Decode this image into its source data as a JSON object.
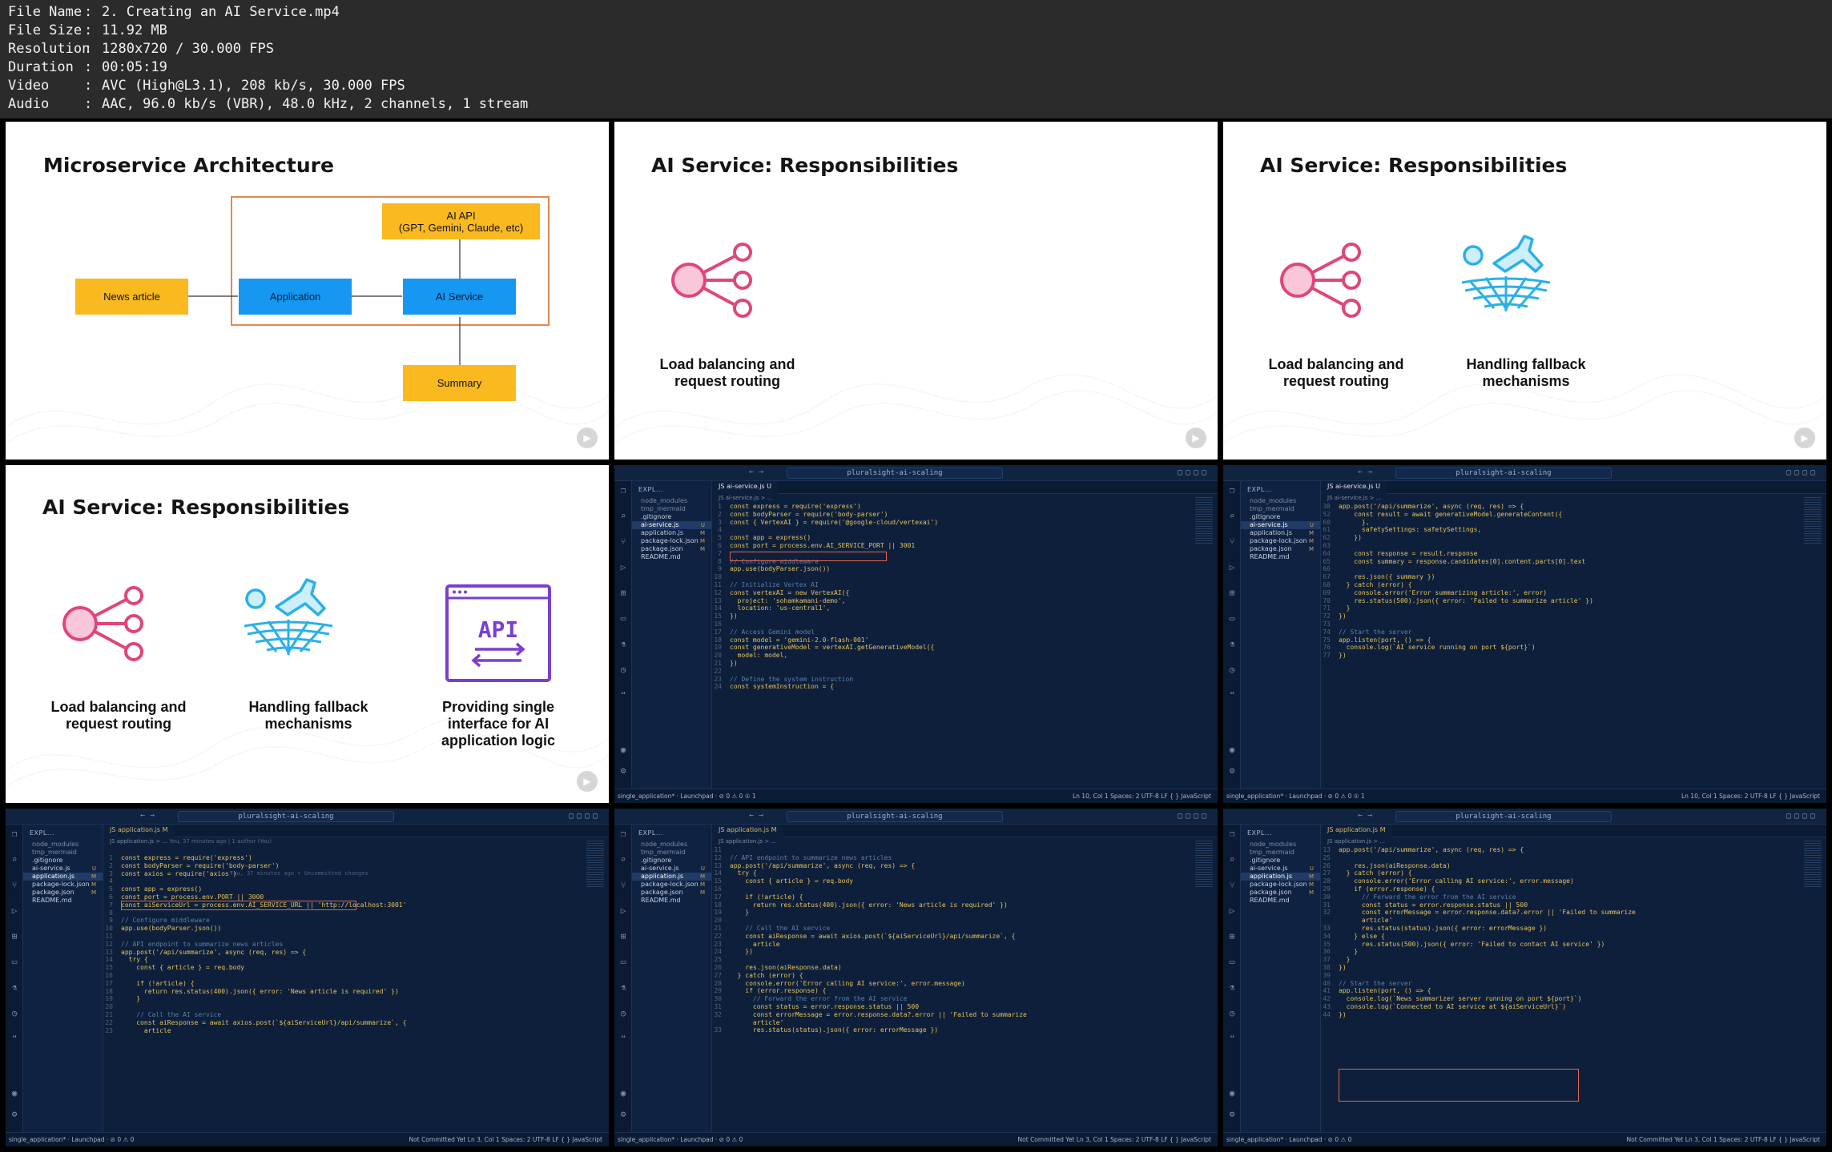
{
  "file_info": [
    {
      "key": "File Name",
      "value": "2. Creating an AI Service.mp4"
    },
    {
      "key": "File Size",
      "value": "11.92 MB"
    },
    {
      "key": "Resolution",
      "value": "1280x720 / 30.000 FPS"
    },
    {
      "key": "Duration",
      "value": "00:05:19"
    },
    {
      "key": "Video",
      "value": "AVC (High@L3.1), 208 kb/s, 30.000 FPS"
    },
    {
      "key": "Audio",
      "value": "AAC, 96.0 kb/s (VBR), 48.0 kHz, 2 channels, 1 stream"
    }
  ],
  "separator": ":",
  "slides": {
    "arch": {
      "title": "Microservice Architecture",
      "news": "News article",
      "application": "Application",
      "ai_service": "AI Service",
      "ai_api": "AI API",
      "ai_api_sub": "(GPT, Gemini, Claude, etc)",
      "summary": "Summary"
    },
    "resp_title": "AI Service: Responsibilities",
    "resp_load": "Load balancing and request routing",
    "resp_fallback": "Handling fallback mechanisms",
    "resp_interface": "Providing single interface for AI application logic",
    "api_icon_text": "API"
  },
  "editor": {
    "search": "pluralsight-ai-scaling",
    "explorer": "EXPL...",
    "files": {
      "node_modules": "node_modules",
      "tmp_mermaid": "tmp_mermaid",
      "gitignore": ".gitignore",
      "ai_service": "ai-service.js",
      "application": "application.js",
      "package_lock": "package-lock.json",
      "package": "package.json",
      "readme": "README.md"
    },
    "status_u": "U",
    "status_m": "M",
    "tab_ai": "JS ai-service.js U",
    "tab_app": "JS application.js M",
    "crumb_ai": "JS ai-service.js > ...",
    "crumb_app": "JS application.js > ...",
    "branch": "single_application*",
    "launchpad": "Launchpad",
    "problems": "⊘ 0 ⚠ 0",
    "problems_1": "⊘ 0 ⚠ 0 ① 1",
    "not_committed": "Not Committed Yet",
    "pos_10": "Ln 10, Col 1",
    "pos_3": "Ln 3, Col 1",
    "spaces": "Spaces: 2",
    "encoding": "UTF-8",
    "eol": "LF",
    "lang": "{ } JavaScript",
    "blame": "You, 37 minutes ago | 1 author (You)",
    "inline_blame": "You, 37 minutes ago • Uncommitted changes",
    "ed1_lines": [
      {
        "n": "1",
        "t": "const express = require('express')"
      },
      {
        "n": "2",
        "t": "const bodyParser = require('body-parser')"
      },
      {
        "n": "3",
        "t": "const { VertexAI } = require('@google-cloud/vertexai')"
      },
      {
        "n": "4",
        "t": ""
      },
      {
        "n": "5",
        "t": "const app = express()"
      },
      {
        "n": "6",
        "t": "const port = process.env.AI_SERVICE_PORT || 3001"
      },
      {
        "n": "7",
        "t": ""
      },
      {
        "n": "8",
        "t": "// Configure middleware"
      },
      {
        "n": "9",
        "t": "app.use(bodyParser.json())"
      },
      {
        "n": "10",
        "t": ""
      },
      {
        "n": "11",
        "t": "// Initialize Vertex AI"
      },
      {
        "n": "12",
        "t": "const vertexAI = new VertexAI({"
      },
      {
        "n": "13",
        "t": "  project: 'sohamkamani-demo',"
      },
      {
        "n": "14",
        "t": "  location: 'us-central1',"
      },
      {
        "n": "15",
        "t": "})"
      },
      {
        "n": "16",
        "t": ""
      },
      {
        "n": "17",
        "t": "// Access Gemini model"
      },
      {
        "n": "18",
        "t": "const model = 'gemini-2.0-flash-001'"
      },
      {
        "n": "19",
        "t": "const generativeModel = vertexAI.getGenerativeModel({"
      },
      {
        "n": "20",
        "t": "  model: model,"
      },
      {
        "n": "21",
        "t": "})"
      },
      {
        "n": "22",
        "t": ""
      },
      {
        "n": "23",
        "t": "// Define the system instruction"
      },
      {
        "n": "24",
        "t": "const systemInstruction = {"
      }
    ],
    "ed2_lines": [
      {
        "n": "38",
        "t": "app.post('/api/summarize', async (req, res) => {"
      },
      {
        "n": "52",
        "t": "    const result = await generativeModel.generateContent({"
      },
      {
        "n": "60",
        "t": "      },"
      },
      {
        "n": "61",
        "t": "      safetySettings: safetySettings,"
      },
      {
        "n": "62",
        "t": "    })"
      },
      {
        "n": "63",
        "t": ""
      },
      {
        "n": "64",
        "t": "    const response = result.response"
      },
      {
        "n": "65",
        "t": "    const summary = response.candidates[0].content.parts[0].text"
      },
      {
        "n": "66",
        "t": ""
      },
      {
        "n": "67",
        "t": "    res.json({ summary })"
      },
      {
        "n": "68",
        "t": "  } catch (error) {"
      },
      {
        "n": "69",
        "t": "    console.error('Error summarizing article:', error)"
      },
      {
        "n": "70",
        "t": "    res.status(500).json({ error: 'Failed to summarize article' })"
      },
      {
        "n": "71",
        "t": "  }"
      },
      {
        "n": "72",
        "t": "})"
      },
      {
        "n": "73",
        "t": ""
      },
      {
        "n": "74",
        "t": "// Start the server"
      },
      {
        "n": "75",
        "t": "app.listen(port, () => {"
      },
      {
        "n": "76",
        "t": "  console.log(`AI service running on port ${port}`)"
      },
      {
        "n": "77",
        "t": "})"
      }
    ],
    "ed3_lines": [
      {
        "n": "1",
        "t": "const express = require('express')"
      },
      {
        "n": "2",
        "t": "const bodyParser = require('body-parser')"
      },
      {
        "n": "3",
        "t": "const axios = require('axios')"
      },
      {
        "n": "4",
        "t": ""
      },
      {
        "n": "5",
        "t": "const app = express()"
      },
      {
        "n": "6",
        "t": "const port = process.env.PORT || 3000"
      },
      {
        "n": "7",
        "t": "const aiServiceUrl = process.env.AI_SERVICE_URL || 'http://localhost:3001'"
      },
      {
        "n": "8",
        "t": ""
      },
      {
        "n": "9",
        "t": "// Configure middleware"
      },
      {
        "n": "10",
        "t": "app.use(bodyParser.json())"
      },
      {
        "n": "11",
        "t": ""
      },
      {
        "n": "12",
        "t": "// API endpoint to summarize news articles"
      },
      {
        "n": "13",
        "t": "app.post('/api/summarize', async (req, res) => {"
      },
      {
        "n": "14",
        "t": "  try {"
      },
      {
        "n": "15",
        "t": "    const { article } = req.body"
      },
      {
        "n": "16",
        "t": ""
      },
      {
        "n": "17",
        "t": "    if (!article) {"
      },
      {
        "n": "18",
        "t": "      return res.status(400).json({ error: 'News article is required' })"
      },
      {
        "n": "19",
        "t": "    }"
      },
      {
        "n": "20",
        "t": ""
      },
      {
        "n": "21",
        "t": "    // Call the AI service"
      },
      {
        "n": "22",
        "t": "    const aiResponse = await axios.post(`${aiServiceUrl}/api/summarize`, {"
      },
      {
        "n": "23",
        "t": "      article"
      }
    ],
    "ed4_lines": [
      {
        "n": "11",
        "t": ""
      },
      {
        "n": "12",
        "t": "// API endpoint to summarize news articles"
      },
      {
        "n": "13",
        "t": "app.post('/api/summarize', async (req, res) => {"
      },
      {
        "n": "14",
        "t": "  try {"
      },
      {
        "n": "15",
        "t": "    const { article } = req.body"
      },
      {
        "n": "16",
        "t": ""
      },
      {
        "n": "17",
        "t": "    if (!article) {"
      },
      {
        "n": "18",
        "t": "      return res.status(400).json({ error: 'News article is required' })"
      },
      {
        "n": "19",
        "t": "    }"
      },
      {
        "n": "20",
        "t": ""
      },
      {
        "n": "21",
        "t": "    // Call the AI service"
      },
      {
        "n": "22",
        "t": "    const aiResponse = await axios.post(`${aiServiceUrl}/api/summarize`, {"
      },
      {
        "n": "23",
        "t": "      article"
      },
      {
        "n": "24",
        "t": "    })"
      },
      {
        "n": "25",
        "t": ""
      },
      {
        "n": "26",
        "t": "    res.json(aiResponse.data)"
      },
      {
        "n": "27",
        "t": "  } catch (error) {"
      },
      {
        "n": "28",
        "t": "    console.error('Error calling AI service:', error.message)"
      },
      {
        "n": "29",
        "t": "    if (error.response) {"
      },
      {
        "n": "30",
        "t": "      // Forward the error from the AI service"
      },
      {
        "n": "31",
        "t": "      const status = error.response.status || 500"
      },
      {
        "n": "32",
        "t": "      const errorMessage = error.response.data?.error || 'Failed to summarize"
      },
      {
        "n": "",
        "t": "      article'"
      },
      {
        "n": "33",
        "t": "      res.status(status).json({ error: errorMessage })"
      }
    ],
    "ed5_lines": [
      {
        "n": "13",
        "t": "app.post('/api/summarize', async (req, res) => {"
      },
      {
        "n": "25",
        "t": ""
      },
      {
        "n": "26",
        "t": "    res.json(aiResponse.data)"
      },
      {
        "n": "27",
        "t": "  } catch (error) {"
      },
      {
        "n": "28",
        "t": "    console.error('Error calling AI service:', error.message)"
      },
      {
        "n": "29",
        "t": "    if (error.response) {"
      },
      {
        "n": "30",
        "t": "      // Forward the error from the AI service"
      },
      {
        "n": "31",
        "t": "      const status = error.response.status || 500"
      },
      {
        "n": "32",
        "t": "      const errorMessage = error.response.data?.error || 'Failed to summarize"
      },
      {
        "n": "",
        "t": "      article'"
      },
      {
        "n": "33",
        "t": "      res.status(status).json({ error: errorMessage })"
      },
      {
        "n": "34",
        "t": "    } else {"
      },
      {
        "n": "35",
        "t": "      res.status(500).json({ error: 'Failed to contact AI service' })"
      },
      {
        "n": "36",
        "t": "    }"
      },
      {
        "n": "37",
        "t": "  }"
      },
      {
        "n": "38",
        "t": "})"
      },
      {
        "n": "39",
        "t": ""
      },
      {
        "n": "40",
        "t": "// Start the server"
      },
      {
        "n": "41",
        "t": "app.listen(port, () => {"
      },
      {
        "n": "42",
        "t": "  console.log(`News summarizer server running on port ${port}`)"
      },
      {
        "n": "43",
        "t": "  console.log(`Connected to AI service at ${aiServiceUrl}`)"
      },
      {
        "n": "44",
        "t": "})"
      }
    ]
  },
  "colors": {
    "header_bg": "#2b2b2b",
    "slide_bg": "#ffffff",
    "yellow_box": "#f9b91f",
    "blue_box": "#1597f2",
    "orange_frame": "#e2894f",
    "pink_icon": "#e0457b",
    "blue_icon": "#2bb0e8",
    "purple_icon": "#7a3fd0",
    "editor_bg": "#0d1f3a",
    "highlight_box": "#e2664e"
  }
}
